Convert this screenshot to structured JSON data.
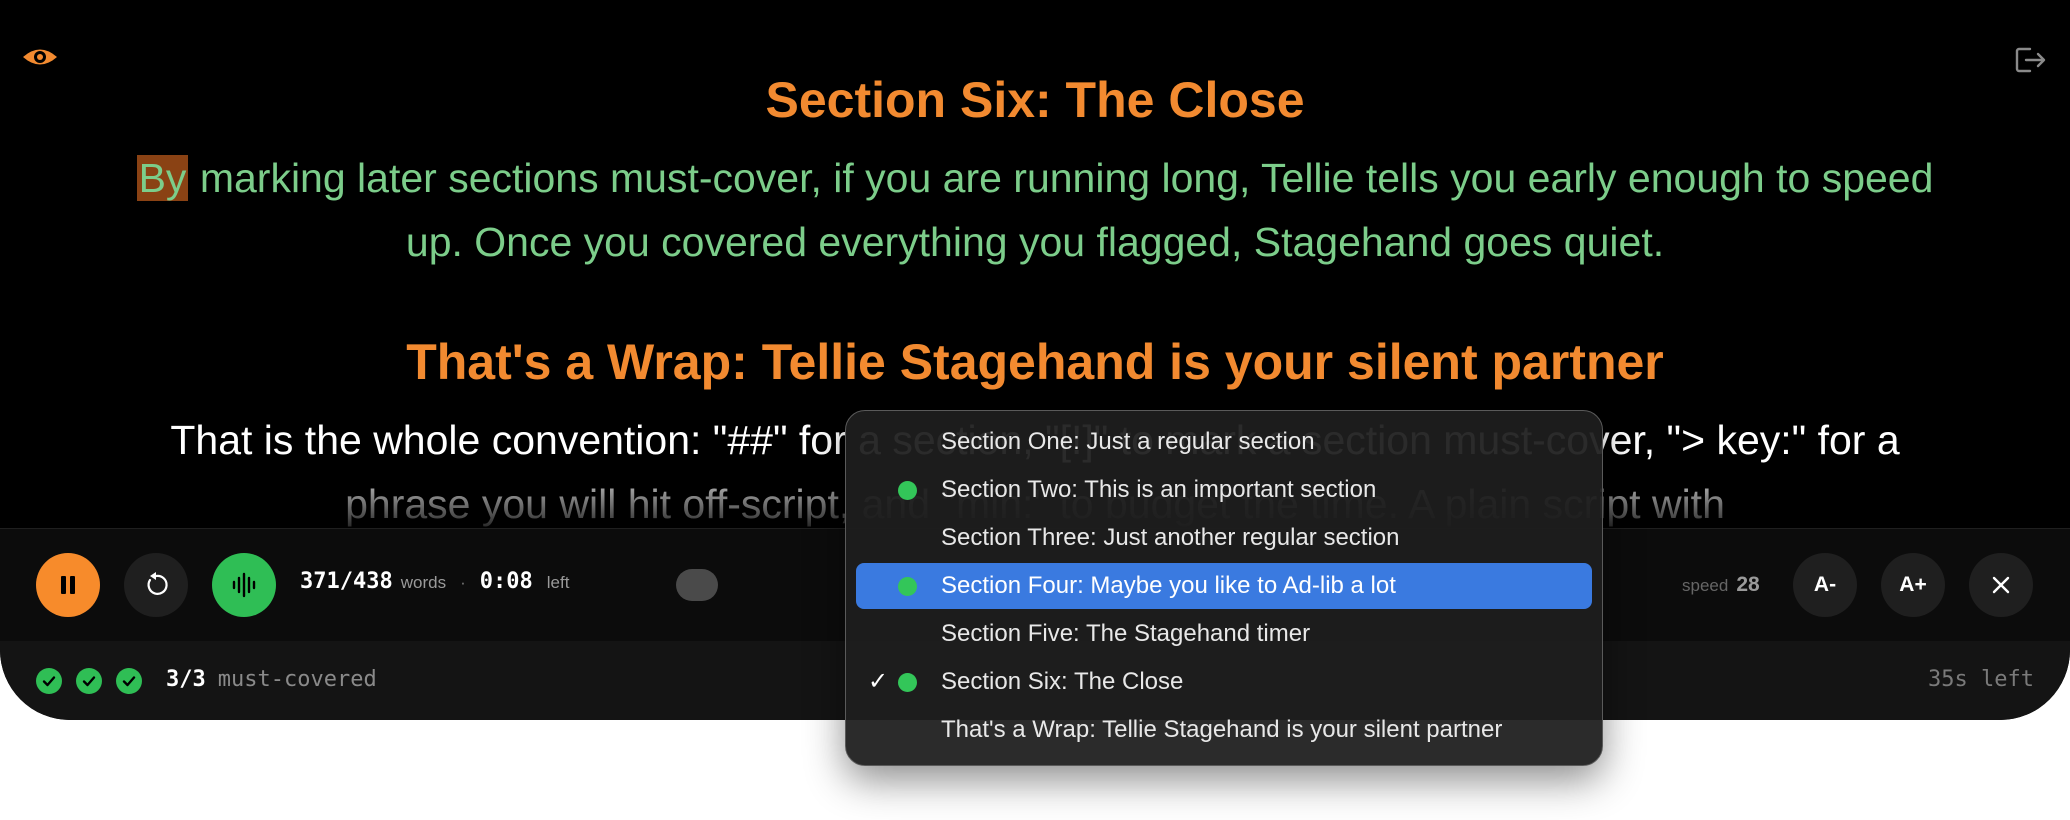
{
  "script": {
    "blocks": [
      {
        "heading": "Section Six: The Close",
        "highlight_word": "By",
        "body_rest": " marking later sections must-cover, if you are running long, Tellie tells you early enough to speed up. Once you covered everything you flagged, Stagehand goes quiet."
      },
      {
        "heading": "That's a Wrap: Tellie Stagehand is your silent partner",
        "body": "That is the whole convention: \"##\" for a section, \"[!]\" to mark a section must-cover, \"> key:\" for a phrase you will hit off-script, and \"min:\" to budget the time. A plain script with"
      }
    ]
  },
  "controls": {
    "words_read": "371/438",
    "words_label": "words",
    "separator": "·",
    "time_left": "0:08",
    "time_left_label": "left",
    "speed_label": "speed",
    "speed_value": "28",
    "font_decrease": "A-",
    "font_increase": "A+"
  },
  "status": {
    "checks_count": 3,
    "covered_count": "3/3",
    "covered_label": "must-covered",
    "time_remaining": "35s left"
  },
  "section_menu": {
    "items": [
      {
        "label": "Section One: Just a regular section",
        "must_cover": false,
        "checked": false,
        "highlighted": false
      },
      {
        "label": "Section Two: This is an important section",
        "must_cover": true,
        "checked": false,
        "highlighted": false
      },
      {
        "label": "Section Three: Just another regular section",
        "must_cover": false,
        "checked": false,
        "highlighted": false
      },
      {
        "label": "Section Four: Maybe you like to Ad-lib a lot",
        "must_cover": true,
        "checked": false,
        "highlighted": true
      },
      {
        "label": "Section Five: The Stagehand timer",
        "must_cover": false,
        "checked": false,
        "highlighted": false
      },
      {
        "label": "Section Six: The Close",
        "must_cover": true,
        "checked": true,
        "highlighted": false
      },
      {
        "label": "That's a Wrap: Tellie Stagehand is your silent partner",
        "must_cover": false,
        "checked": false,
        "highlighted": false
      }
    ],
    "check_glyph": "✓"
  },
  "colors": {
    "accent_orange": "#f28a30",
    "read_text_green": "#7ccd8a",
    "status_green": "#2fbe55",
    "menu_selection_blue": "#3a7ae0"
  },
  "icons": [
    "eye-icon",
    "exit-icon",
    "pause-icon",
    "reset-icon",
    "waveform-icon",
    "close-icon",
    "check-icon"
  ]
}
